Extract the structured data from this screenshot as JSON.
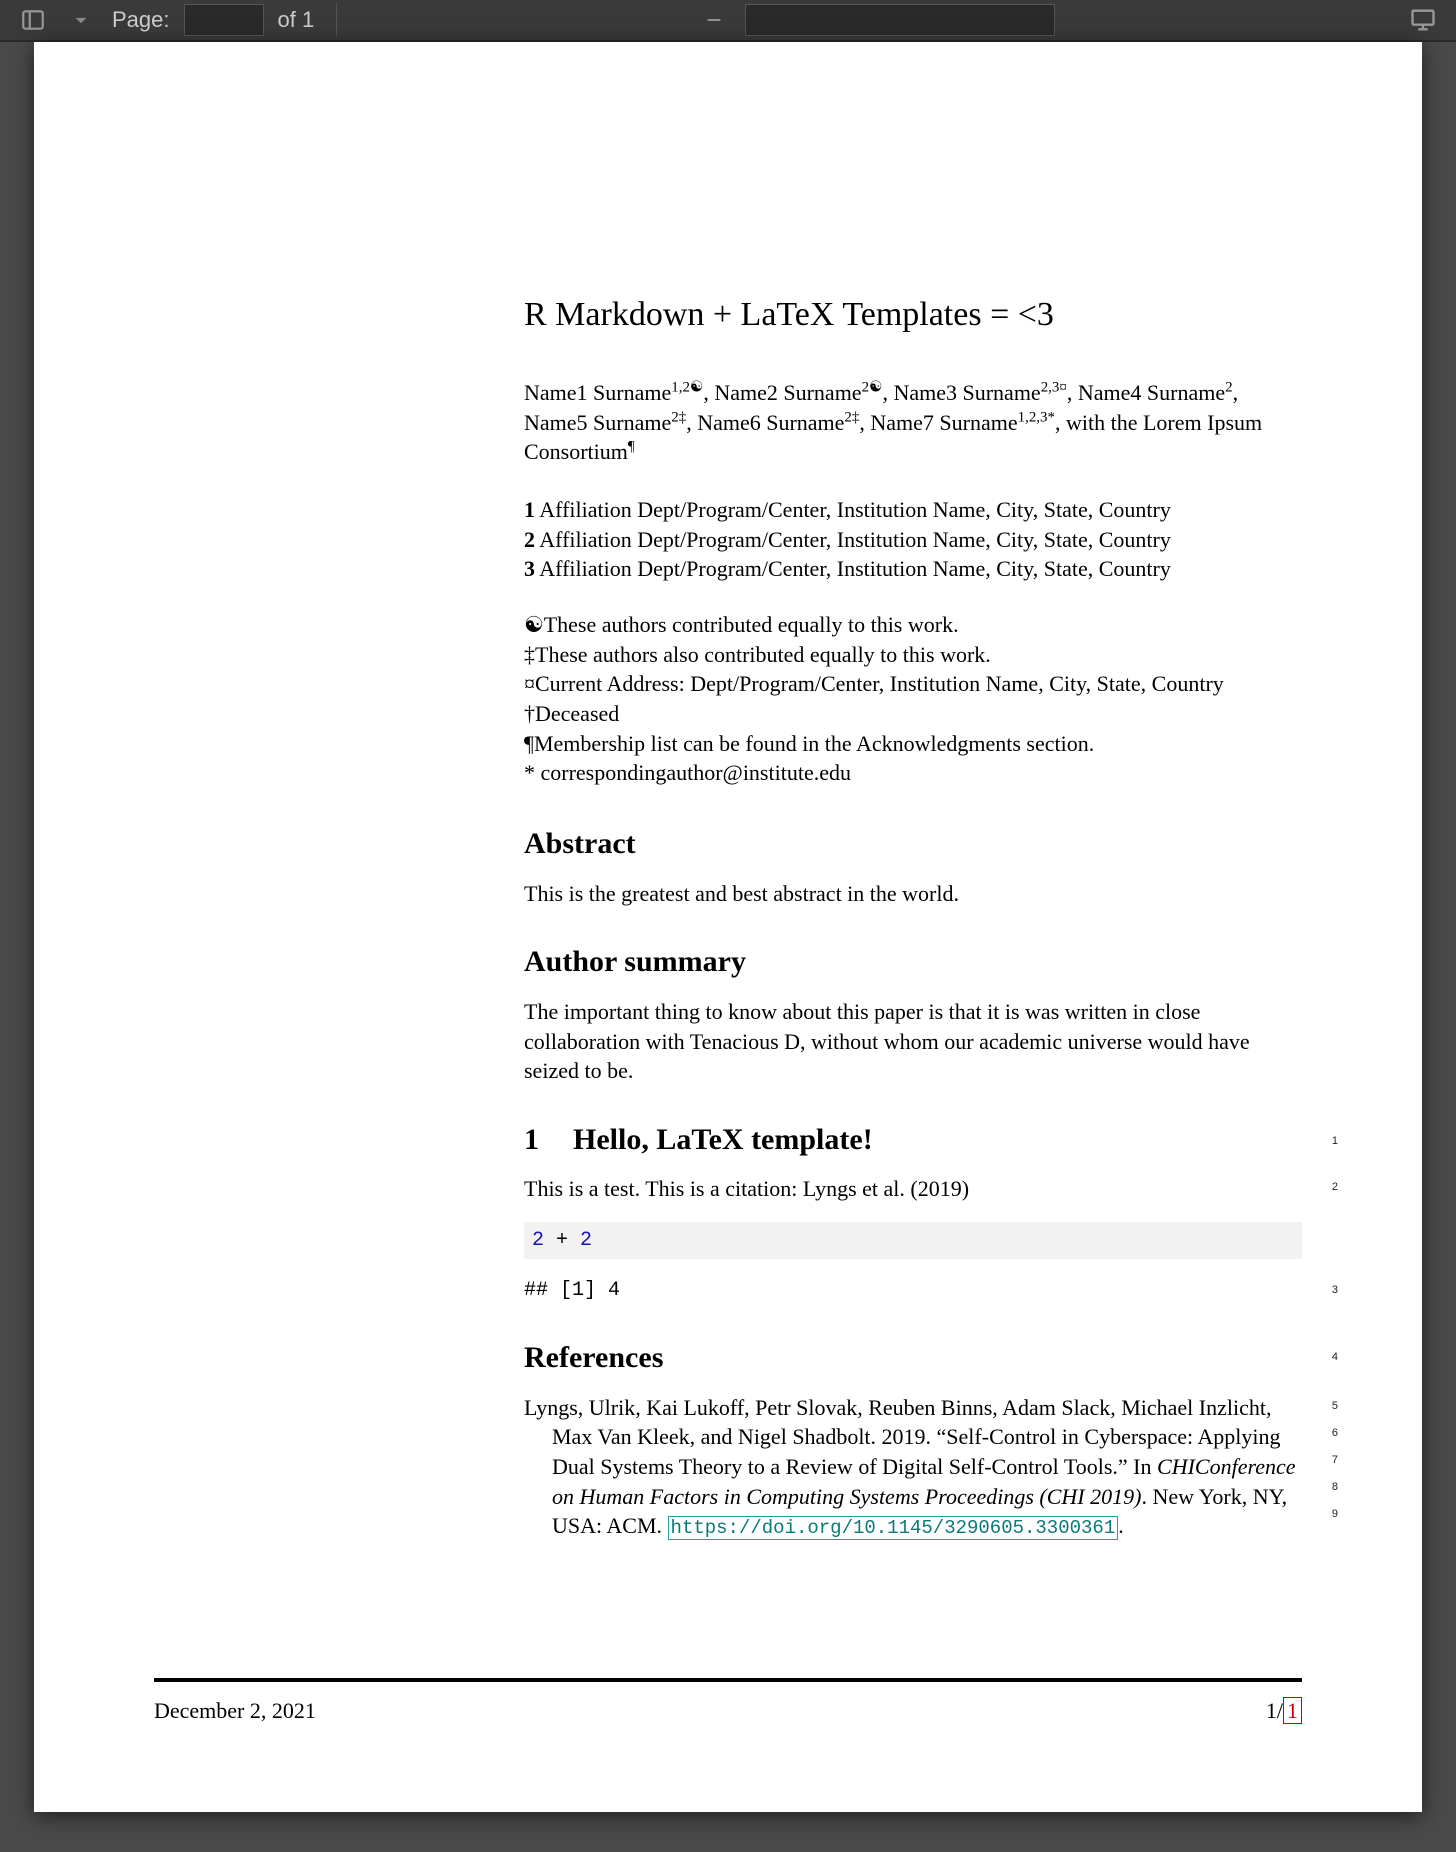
{
  "toolbar": {
    "page_label": "Page:",
    "page_num": "",
    "page_of": "of 1"
  },
  "title": "R Markdown + LaTeX Templates = <3",
  "authors": {
    "a1": {
      "name": "Name1 Surname",
      "sup": "1,2☯"
    },
    "a2": {
      "name": "Name2 Surname",
      "sup": "2☯"
    },
    "a3": {
      "name": "Name3 Surname",
      "sup": "2,3¤"
    },
    "a4": {
      "name": "Name4 Surname",
      "sup": "2"
    },
    "a5": {
      "name": "Name5 Surname",
      "sup": "2‡"
    },
    "a6": {
      "name": "Name6 Surname",
      "sup": "2‡"
    },
    "a7": {
      "name": "Name7 Surname",
      "sup": "1,2,3*"
    },
    "consortium": ", with the Lorem Ipsum Consortium",
    "consortium_sup": "¶"
  },
  "affiliations": {
    "l1": {
      "num": "1",
      "text": " Affiliation Dept/Program/Center, Institution Name, City, State, Country"
    },
    "l2": {
      "num": "2",
      "text": " Affiliation Dept/Program/Center, Institution Name, City, State, Country"
    },
    "l3": {
      "num": "3",
      "text": " Affiliation Dept/Program/Center, Institution Name, City, State, Country"
    }
  },
  "notes": {
    "n1": "☯These authors contributed equally to this work.",
    "n2": "‡These authors also contributed equally to this work.",
    "n3": "¤Current Address: Dept/Program/Center, Institution Name, City, State, Country",
    "n4": "†Deceased",
    "n5": "¶Membership list can be found in the Acknowledgments section.",
    "n6": "* correspondingauthor@institute.edu"
  },
  "abstract": {
    "heading": "Abstract",
    "text": "This is the greatest and best abstract in the world."
  },
  "summary": {
    "heading": "Author summary",
    "text": "The important thing to know about this paper is that it is was written in close collaboration with Tenacious D, without whom our academic universe would have seized to be."
  },
  "section1": {
    "num": "1",
    "title": "Hello, LaTeX template!",
    "body": "This is a test. This is a citation: Lyngs et al. (2019)",
    "code": {
      "n1": "2",
      "plus": " + ",
      "n2": "2"
    },
    "output": "## [1] 4"
  },
  "references": {
    "heading": "References",
    "r1": {
      "pre": "Lyngs, Ulrik, Kai Lukoff, Petr Slovak, Reuben Binns, Adam Slack, Michael Inzlicht, Max Van Kleek, and Nigel Shadbolt. 2019. “Self-Control in Cyberspace: Applying Dual Systems Theory to a Review of Digital Self-Control Tools.” In ",
      "em": "CHIConference on Human Factors in Computing Systems Proceedings (CHI 2019)",
      "post": ". New York, NY, USA: ACM. ",
      "doi": "https://doi.org/10.1145/3290605.3300361",
      "end": "."
    }
  },
  "linenums": {
    "l1": "1",
    "l2": "2",
    "l3": "3",
    "l4": "4",
    "l5": "5",
    "l6": "6",
    "l7": "7",
    "l8": "8",
    "l9": "9"
  },
  "footer": {
    "date": "December 2, 2021",
    "page_cur": "1/",
    "page_total": "1"
  }
}
